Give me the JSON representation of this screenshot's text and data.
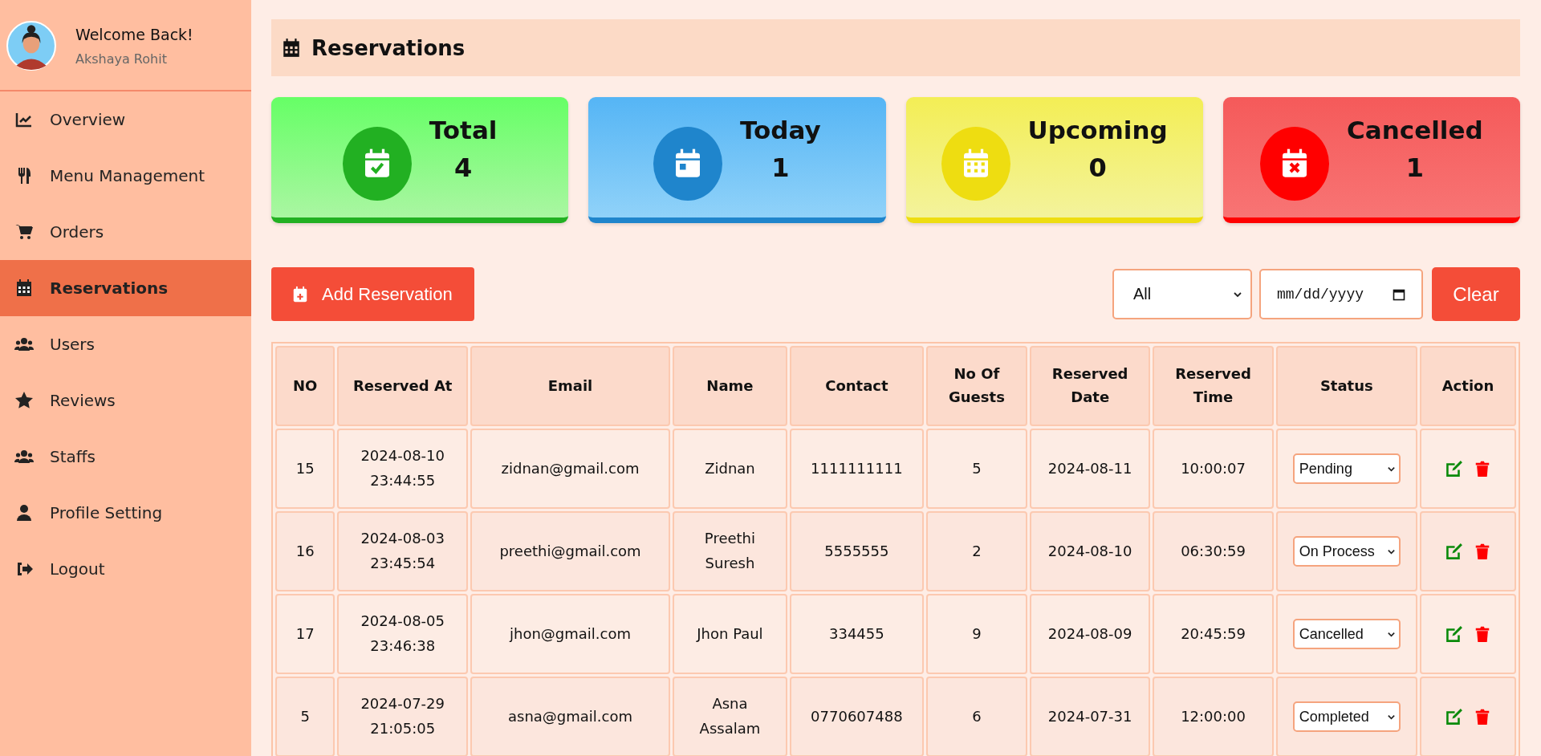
{
  "sidebar": {
    "welcome": "Welcome Back!",
    "user": "Akshaya Rohit",
    "items": [
      {
        "kind": "chart",
        "label": "Overview",
        "selected": false
      },
      {
        "kind": "utensils",
        "label": "Menu Management",
        "selected": false
      },
      {
        "kind": "cart",
        "label": "Orders",
        "selected": false
      },
      {
        "kind": "calendar",
        "label": "Reservations",
        "selected": true
      },
      {
        "kind": "users",
        "label": "Users",
        "selected": false
      },
      {
        "kind": "star",
        "label": "Reviews",
        "selected": false
      },
      {
        "kind": "users",
        "label": "Staffs",
        "selected": false
      },
      {
        "kind": "user",
        "label": "Profile Setting",
        "selected": false
      },
      {
        "kind": "logout",
        "label": "Logout",
        "selected": false
      }
    ]
  },
  "page_title": "Reservations",
  "cards": [
    {
      "kind": "total",
      "label": "Total",
      "value": "4",
      "color": "#22b022"
    },
    {
      "kind": "today",
      "label": "Today",
      "value": "1",
      "color": "#1f85cc"
    },
    {
      "kind": "upcoming",
      "label": "Upcoming",
      "value": "0",
      "color": "#eedd11"
    },
    {
      "kind": "cancelled",
      "label": "Cancelled",
      "value": "1",
      "color": "#ff0000"
    }
  ],
  "add_button": "Add Reservation",
  "filter": {
    "status": "All",
    "date_placeholder": "mm/dd/yyyy",
    "clear": "Clear"
  },
  "table": {
    "columns": [
      "NO",
      "Reserved At",
      "Email",
      "Name",
      "Contact",
      "No Of Guests",
      "Reserved Date",
      "Reserved Time",
      "Status",
      "Action"
    ],
    "rows": [
      {
        "no": "15",
        "reserved_at": "2024-08-10 23:44:55",
        "email": "zidnan@gmail.com",
        "name": "Zidnan",
        "contact": "1111111111",
        "guests": "5",
        "date": "2024-08-11",
        "time": "10:00:07",
        "status": "Pending"
      },
      {
        "no": "16",
        "reserved_at": "2024-08-03 23:45:54",
        "email": "preethi@gmail.com",
        "name": "Preethi Suresh",
        "contact": "5555555",
        "guests": "2",
        "date": "2024-08-10",
        "time": "06:30:59",
        "status": "On Process"
      },
      {
        "no": "17",
        "reserved_at": "2024-08-05 23:46:38",
        "email": "jhon@gmail.com",
        "name": "Jhon Paul",
        "contact": "334455",
        "guests": "9",
        "date": "2024-08-09",
        "time": "20:45:59",
        "status": "Cancelled"
      },
      {
        "no": "5",
        "reserved_at": "2024-07-29 21:05:05",
        "email": "asna@gmail.com",
        "name": "Asna Assalam",
        "contact": "0770607488",
        "guests": "6",
        "date": "2024-07-31",
        "time": "12:00:00",
        "status": "Completed"
      }
    ]
  }
}
